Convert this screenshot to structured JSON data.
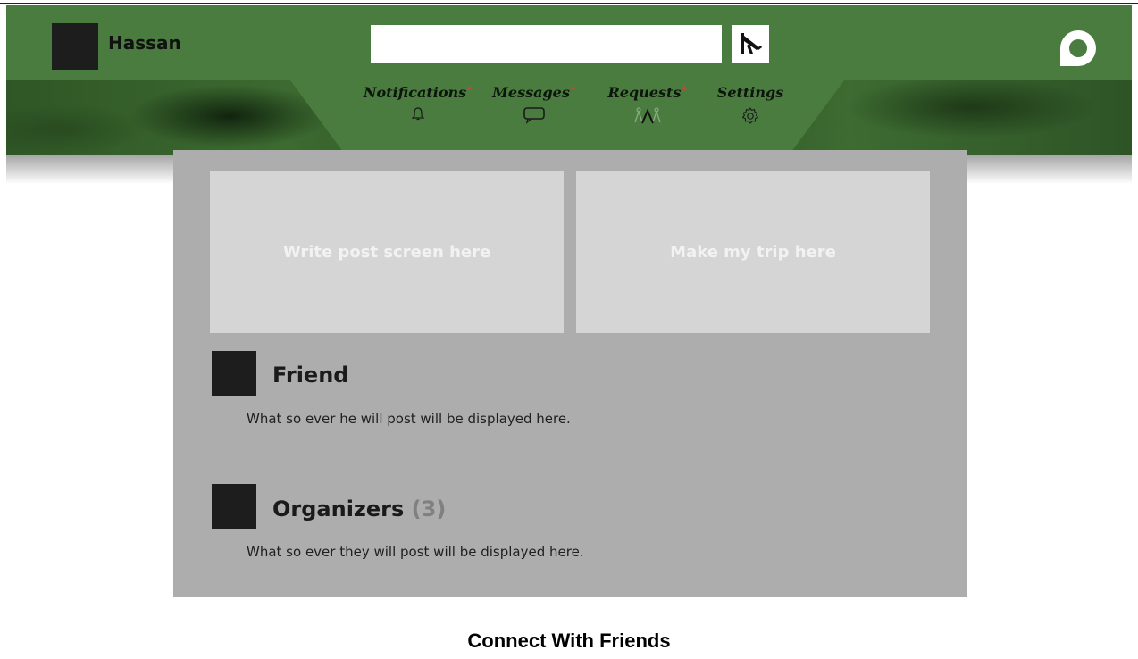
{
  "header": {
    "username": "Hassan",
    "search": {
      "value": "",
      "placeholder": ""
    },
    "search_button_icon": "airplane-icon",
    "logo_icon": "app-logo-icon",
    "brand_color": "#4a7b3f"
  },
  "nav": {
    "items": [
      {
        "label": "Notifications",
        "marker": "*",
        "icon": "bell-icon"
      },
      {
        "label": "Messages",
        "marker": "*",
        "icon": "chat-icon"
      },
      {
        "label": "Requests",
        "marker": "*",
        "icon": "people-icon"
      },
      {
        "label": "Settings",
        "marker": "",
        "icon": "gear-icon"
      }
    ],
    "marker_color": "#e23b3b"
  },
  "main": {
    "write_post": "Write post screen here",
    "make_trip": "Make my trip here",
    "friend": {
      "title": "Friend",
      "text": "What so ever he will post will be displayed here."
    },
    "organizers": {
      "title": "Organizers",
      "count": "(3)",
      "text": "What so ever they will post will be displayed here."
    }
  },
  "caption": "Connect With Friends"
}
